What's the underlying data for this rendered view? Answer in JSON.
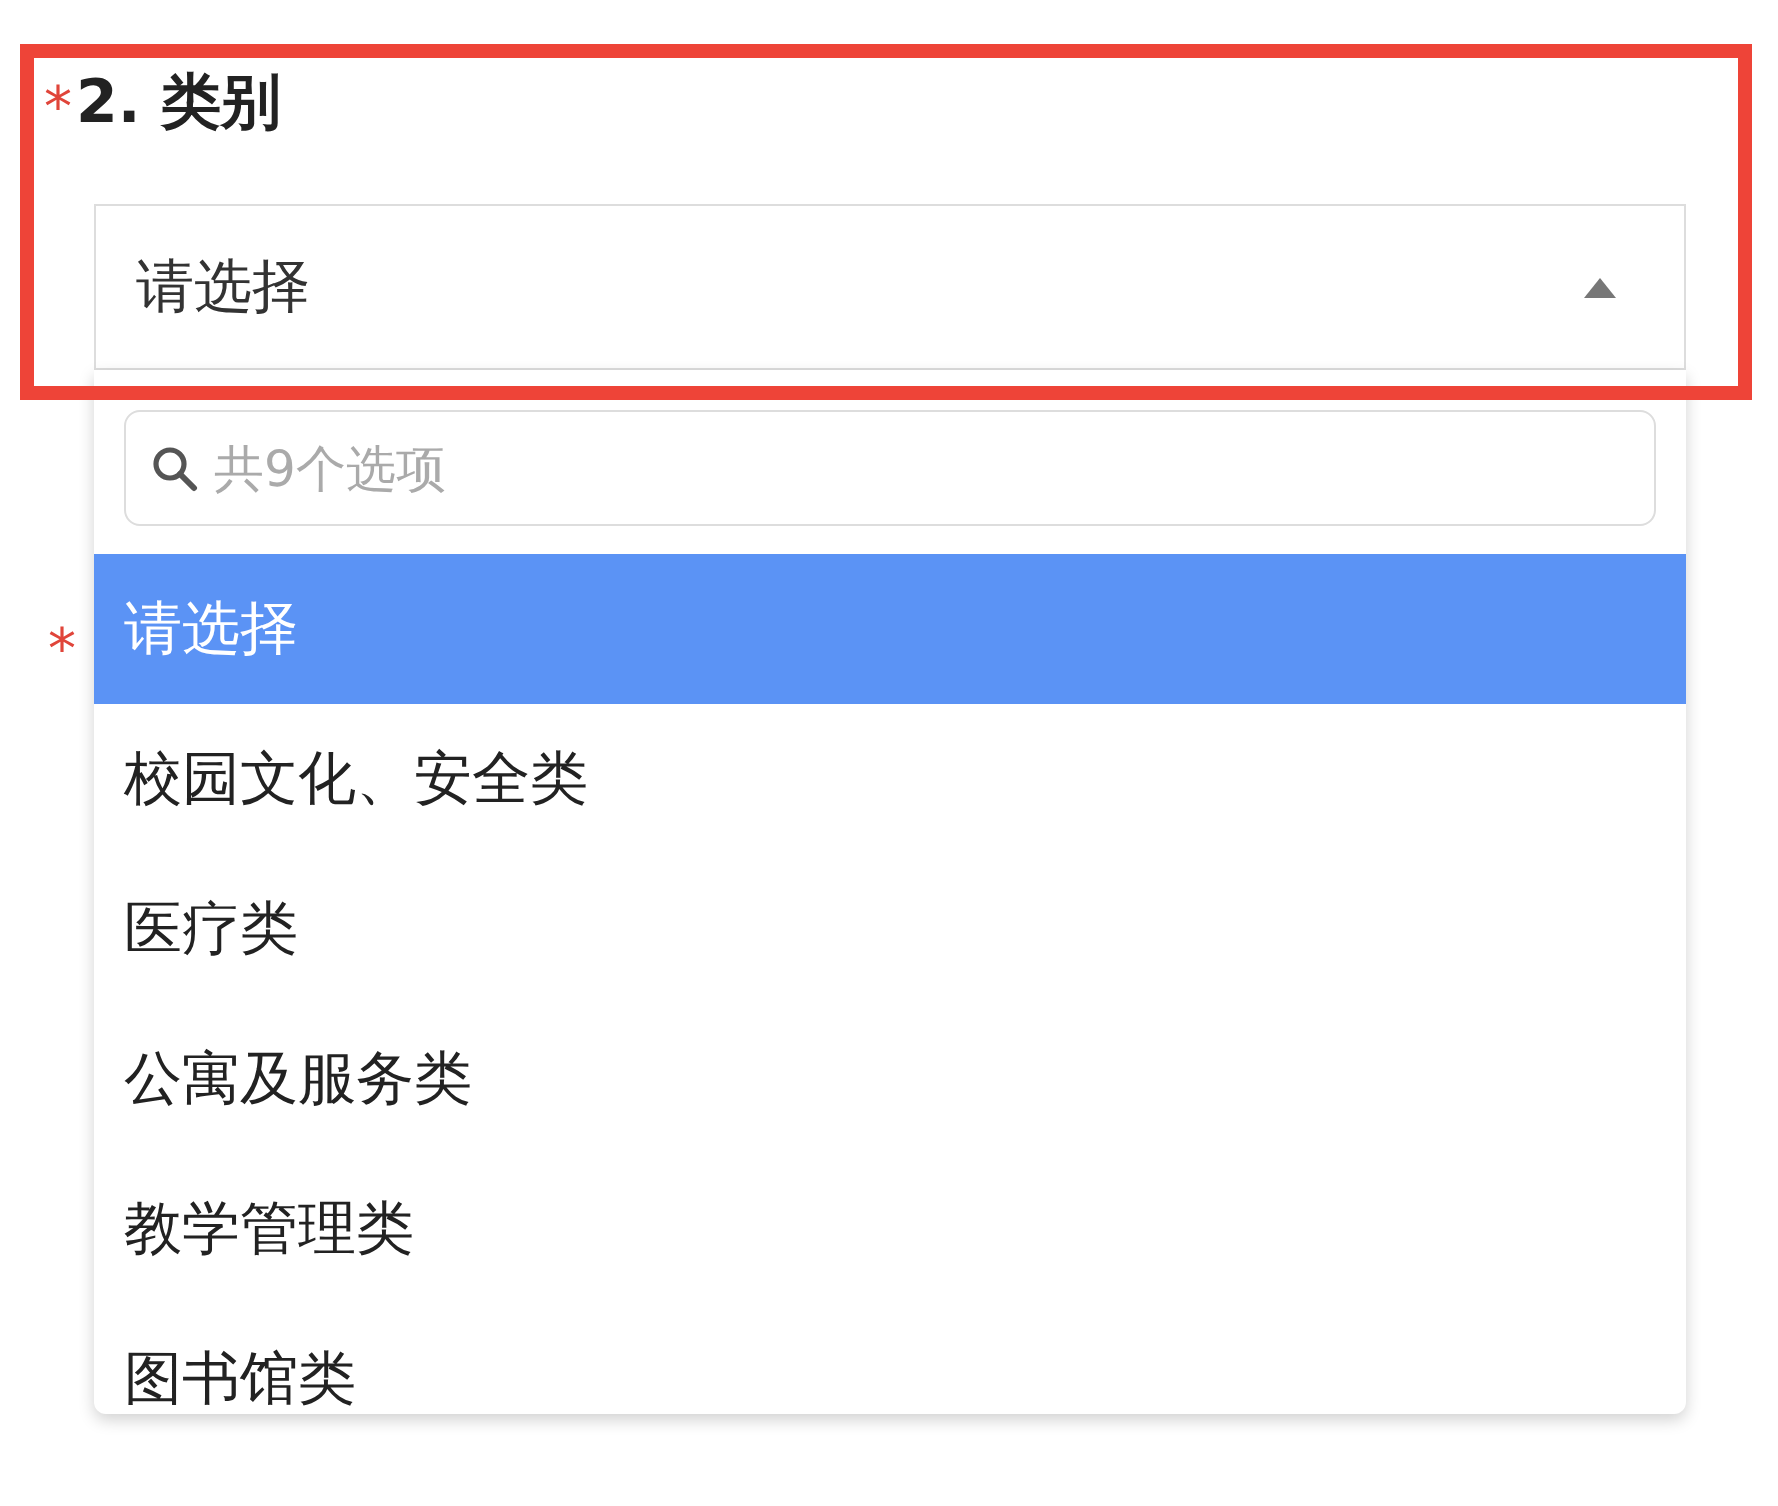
{
  "question": {
    "required": true,
    "required_mark": "*",
    "title": "2. 类别"
  },
  "select": {
    "value": "请选择",
    "expanded": true
  },
  "dropdown": {
    "search": {
      "placeholder": "共9个选项"
    },
    "options": [
      {
        "label": "请选择",
        "selected": true
      },
      {
        "label": "校园文化、安全类",
        "selected": false
      },
      {
        "label": "医疗类",
        "selected": false
      },
      {
        "label": "公寓及服务类",
        "selected": false
      },
      {
        "label": "教学管理类",
        "selected": false
      },
      {
        "label": "图书馆类",
        "selected": false
      }
    ]
  },
  "next_question": {
    "required_mark": "*"
  },
  "highlight": {
    "kind": "frame"
  }
}
